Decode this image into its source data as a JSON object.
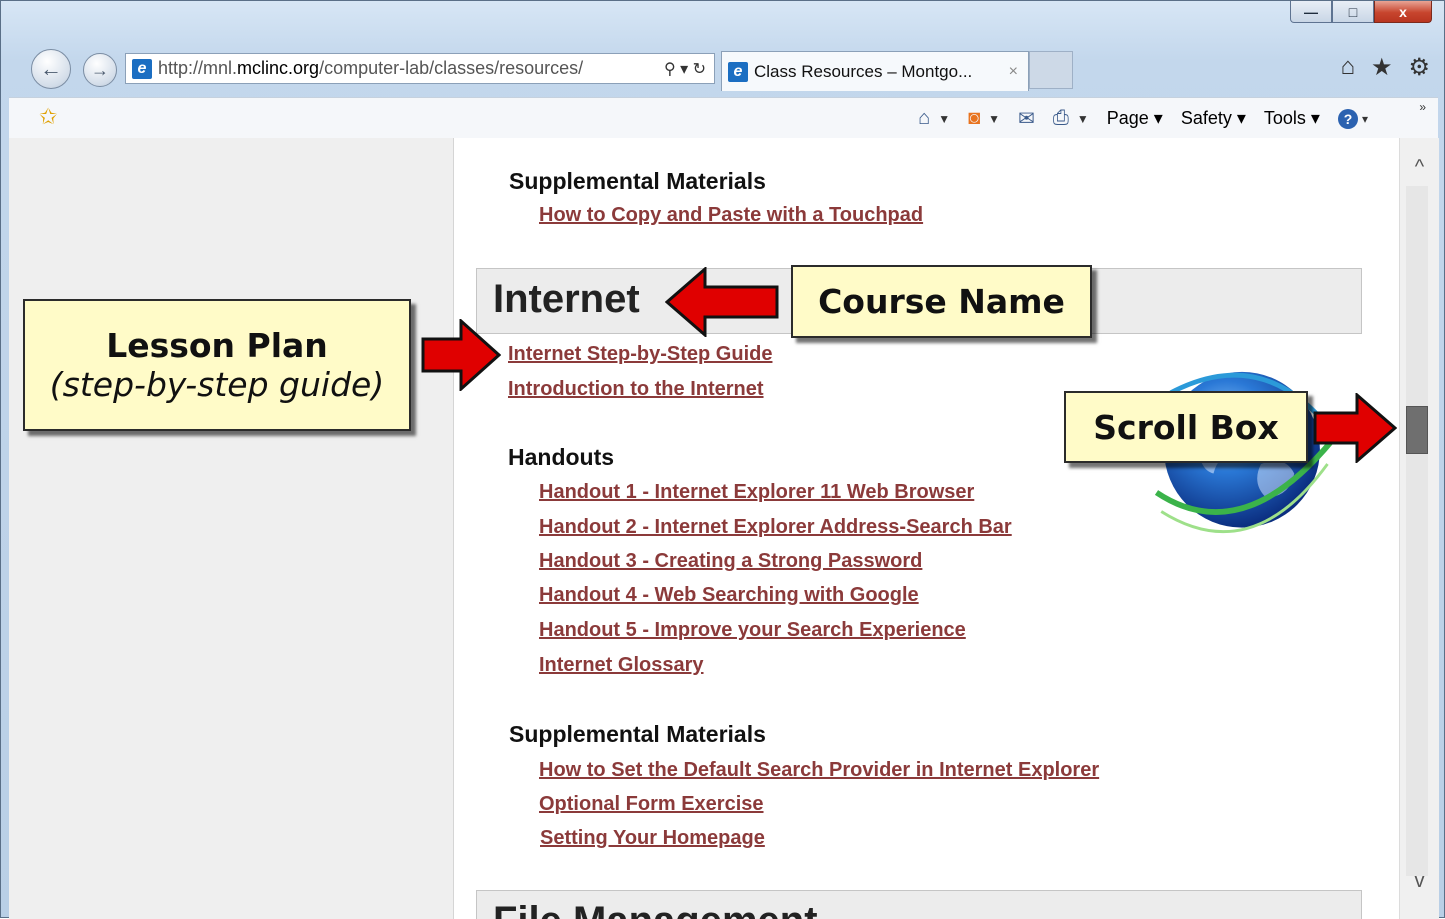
{
  "window": {
    "caption_buttons": {
      "minimize": "—",
      "maximize": "□",
      "close": "x"
    }
  },
  "nav": {
    "back_icon": "back-arrow-icon",
    "forward_icon": "forward-arrow-icon",
    "address_prefix": "http://mnl.",
    "address_domain": "mclinc.org",
    "address_suffix": "/computer-lab/classes/resources/",
    "address_controls": "⚲ ▾ ↻",
    "tab_title": "Class Resources – Montgo...",
    "tab_close": "×",
    "right_icons": [
      "⌂",
      "★",
      "⚙"
    ]
  },
  "command_bar": {
    "page_label": "Page",
    "safety_label": "Safety",
    "tools_label": "Tools",
    "help_icon": "?",
    "overflow": "»"
  },
  "content": {
    "top_section_heading": "Supplemental Materials",
    "top_links": [
      "How to Copy and Paste with a Touchpad"
    ],
    "course_title": "Internet",
    "lesson_links": [
      "Internet Step-by-Step Guide",
      "Introduction to the Internet"
    ],
    "handouts_heading": "Handouts",
    "handouts": [
      "Handout 1 - Internet Explorer 11 Web Browser",
      "Handout 2 - Internet Explorer Address-Search Bar",
      "Handout 3 - Creating a Strong Password",
      "Handout 4 - Web Searching with Google",
      "Handout 5 - Improve your Search Experience",
      "Internet Glossary"
    ],
    "supplemental_heading": "Supplemental Materials",
    "supplemental_links": [
      "How to Set the Default Search Provider in Internet Explorer",
      "Optional Form Exercise",
      "Setting Your Homepage"
    ],
    "next_course_title": "File Management"
  },
  "scrollbar": {
    "up": "^",
    "down": "v"
  },
  "callouts": {
    "lesson_plan_title": "Lesson Plan",
    "lesson_plan_sub": "(step-by-step guide)",
    "course_name": "Course Name",
    "scroll_box": "Scroll Box"
  },
  "colors": {
    "link": "#8b3a3a",
    "callout_bg": "#fffbc8",
    "arrow_red": "#e00000",
    "left_pane": "#efefef"
  }
}
